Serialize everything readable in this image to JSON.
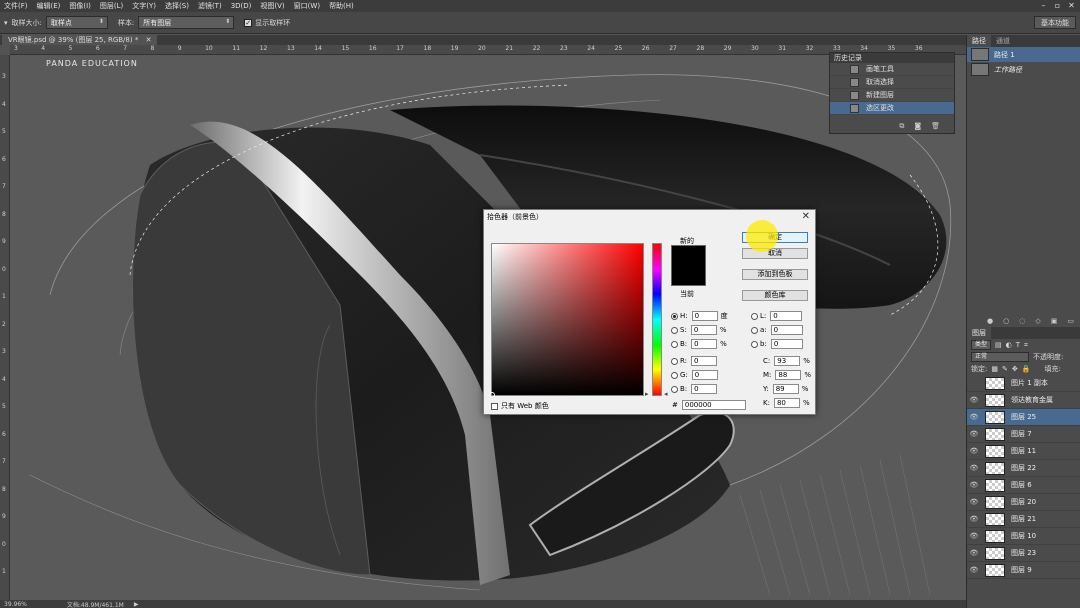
{
  "menu": [
    "文件(F)",
    "编辑(E)",
    "图像(I)",
    "图层(L)",
    "文字(Y)",
    "选择(S)",
    "滤镜(T)",
    "3D(D)",
    "视图(V)",
    "窗口(W)",
    "帮助(H)"
  ],
  "options": {
    "sample_size_label": "取样大小:",
    "sample_size_value": "取样点",
    "sample_label": "样本:",
    "sample_value": "所有图层",
    "show_ring_label": "显示取样环",
    "workspace": "基本功能"
  },
  "document": {
    "tab": "VR眼镜.psd @ 39% (图层 25, RGB/8) *",
    "watermark": "PANDA   EDUCATION",
    "zoom": "39.96%",
    "docinfo": "文档:48.9M/461.1M"
  },
  "ruler_top": [
    "3",
    "4",
    "5",
    "6",
    "7",
    "8",
    "9",
    "10",
    "11",
    "12",
    "13",
    "14",
    "15",
    "16",
    "17",
    "18",
    "19",
    "20",
    "21",
    "22",
    "23",
    "24",
    "25",
    "26",
    "27",
    "28",
    "29",
    "30",
    "31",
    "32",
    "33",
    "34",
    "35",
    "36"
  ],
  "ruler_left": [
    "3",
    "4",
    "5",
    "6",
    "7",
    "8",
    "9",
    "0",
    "1",
    "2",
    "3",
    "4",
    "5",
    "6",
    "7",
    "8",
    "9",
    "0",
    "1"
  ],
  "history": {
    "title": "历史记录",
    "items": [
      "画笔工具",
      "取消选择",
      "新建图层",
      "选区更改"
    ],
    "selected": 3
  },
  "paths_panel": {
    "tabs": [
      "路径",
      "通道"
    ],
    "items": [
      {
        "name": "路径 1",
        "selected": true,
        "italic": false
      },
      {
        "name": "工作路径",
        "selected": false,
        "italic": true
      }
    ]
  },
  "layers_panel": {
    "tab": "图层",
    "kind_label": "类型",
    "mode": "正常",
    "opacity_label": "不透明度:",
    "lock_label": "锁定:",
    "fill_label": "填充:",
    "items": [
      {
        "name": "图片 1 副本",
        "visible": false,
        "selected": false
      },
      {
        "name": "领达教育金属",
        "visible": true,
        "selected": false
      },
      {
        "name": "图层 25",
        "visible": true,
        "selected": true
      },
      {
        "name": "图层 7",
        "visible": true,
        "selected": false
      },
      {
        "name": "图层 11",
        "visible": true,
        "selected": false
      },
      {
        "name": "图层 22",
        "visible": true,
        "selected": false
      },
      {
        "name": "图层 6",
        "visible": true,
        "selected": false
      },
      {
        "name": "图层 20",
        "visible": true,
        "selected": false
      },
      {
        "name": "图层 21",
        "visible": true,
        "selected": false
      },
      {
        "name": "图层 10",
        "visible": true,
        "selected": false
      },
      {
        "name": "图层 23",
        "visible": true,
        "selected": false
      },
      {
        "name": "图层 9",
        "visible": true,
        "selected": false
      }
    ]
  },
  "color_picker": {
    "title": "拾色器（前景色）",
    "new_label": "新的",
    "current_label": "当前",
    "ok": "确定",
    "cancel": "取消",
    "add_swatch": "添加到色板",
    "libraries": "颜色库",
    "web_only": "只有 Web 颜色",
    "hex_label": "#",
    "hex": "000000",
    "fields": {
      "H": {
        "label": "H:",
        "value": "0",
        "unit": "度"
      },
      "S": {
        "label": "S:",
        "value": "0",
        "unit": "%"
      },
      "Bv": {
        "label": "B:",
        "value": "0",
        "unit": "%"
      },
      "R": {
        "label": "R:",
        "value": "0",
        "unit": ""
      },
      "G": {
        "label": "G:",
        "value": "0",
        "unit": ""
      },
      "Bb": {
        "label": "B:",
        "value": "0",
        "unit": ""
      },
      "L": {
        "label": "L:",
        "value": "0",
        "unit": ""
      },
      "a": {
        "label": "a:",
        "value": "0",
        "unit": ""
      },
      "b": {
        "label": "b:",
        "value": "0",
        "unit": ""
      },
      "C": {
        "label": "C:",
        "value": "93",
        "unit": "%"
      },
      "M": {
        "label": "M:",
        "value": "88",
        "unit": "%"
      },
      "Y": {
        "label": "Y:",
        "value": "89",
        "unit": "%"
      },
      "K": {
        "label": "K:",
        "value": "80",
        "unit": "%"
      }
    }
  },
  "colors": {
    "selection": "#486a91",
    "panel": "#4b4b4b",
    "current_color": "#000000"
  }
}
